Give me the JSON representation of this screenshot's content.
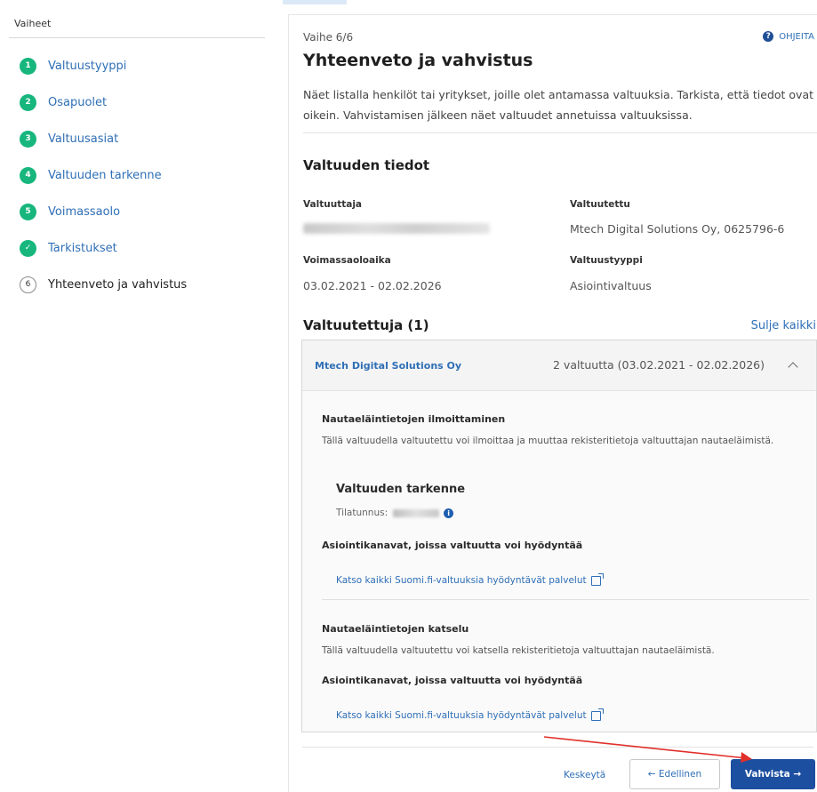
{
  "sidebar": {
    "title": "Vaiheet",
    "steps": [
      {
        "number": "1",
        "label": "Valtuustyyppi",
        "status": "done"
      },
      {
        "number": "2",
        "label": "Osapuolet",
        "status": "done"
      },
      {
        "number": "3",
        "label": "Valtuusasiat",
        "status": "done"
      },
      {
        "number": "4",
        "label": "Valtuuden tarkenne",
        "status": "done"
      },
      {
        "number": "5",
        "label": "Voimassaolo",
        "status": "done"
      },
      {
        "number": "✓",
        "label": "Tarkistukset",
        "status": "done"
      },
      {
        "number": "6",
        "label": "Yhteenveto ja vahvistus",
        "status": "current"
      }
    ]
  },
  "header": {
    "step_counter": "Vaihe 6/6",
    "help_label": "OHJEITA",
    "help_icon": "question-icon",
    "title": "Yhteenveto ja vahvistus",
    "intro": "Näet listalla henkilöt tai yritykset, joille olet antamassa valtuuksia. Tarkista, että tiedot ovat oikein. Vahvistamisen jälkeen näet valtuudet annetuissa valtuuksissa."
  },
  "details": {
    "title": "Valtuuden tiedot",
    "grantor_label": "Valtuuttaja",
    "grantee_label": "Valtuutettu",
    "grantee_value": "Mtech Digital Solutions Oy, 0625796-6",
    "validity_label": "Voimassaoloaika",
    "validity_value": "03.02.2021 - 02.02.2026",
    "type_label": "Valtuustyyppi",
    "type_value": "Asiointivaltuus"
  },
  "grantees": {
    "title": "Valtuutettuja (1)",
    "collapse_all": "Sulje kaikki",
    "card": {
      "name": "Mtech Digital Solutions Oy",
      "summary": "2 valtuutta (03.02.2021 - 02.02.2026)",
      "permissions": [
        {
          "title": "Nautaeläintietojen ilmoittaminen",
          "description": "Tällä valtuudella valtuutettu voi ilmoittaa ja muuttaa rekisteritietoja valtuuttajan nautaeläimistä.",
          "specifier_title": "Valtuuden tarkenne",
          "specifier_label": "Tilatunnus:",
          "channels_title": "Asiointikanavat, joissa valtuutta voi hyödyntää",
          "services_link": "Katso kaikki Suomi.fi-valtuuksia hyödyntävät palvelut"
        },
        {
          "title": "Nautaeläintietojen katselu",
          "description": "Tällä valtuudella valtuutettu voi katsella rekisteritietoja valtuuttajan nautaeläimistä.",
          "channels_title": "Asiointikanavat, joissa valtuutta voi hyödyntää",
          "services_link": "Katso kaikki Suomi.fi-valtuuksia hyödyntävät palvelut"
        }
      ]
    }
  },
  "footer": {
    "cancel_label": "Keskeytä",
    "previous_label": "← Edellinen",
    "confirm_label": "Vahvista →"
  },
  "colors": {
    "step_done": "#17b67d",
    "link": "#2f6fb6",
    "primary_button": "#1d4fa0",
    "annotation_arrow": "#e0302a"
  }
}
